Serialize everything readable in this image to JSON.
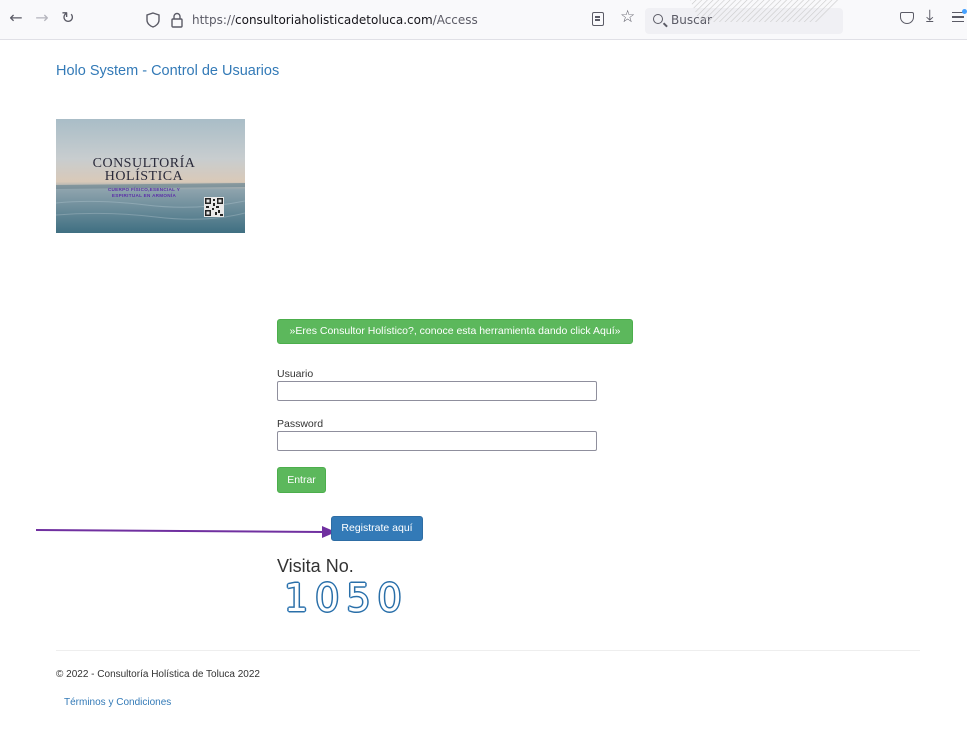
{
  "browser": {
    "url_prefix": "https://",
    "url_host": "consultoriaholisticadetoluca.com",
    "url_path": "/Access",
    "search_placeholder": "Buscar",
    "icons": [
      "back-arrow-icon",
      "forward-arrow-icon",
      "reload-icon",
      "shield-icon",
      "lock-icon",
      "reader-view-icon",
      "bookmark-star-icon",
      "search-icon",
      "pocket-icon",
      "download-icon",
      "menu-icon"
    ]
  },
  "header": {
    "brand": "Holo System - Control de Usuarios"
  },
  "banner": {
    "title_line1": "CONSULTORÍA",
    "title_line2": "HOLÍSTICA",
    "subtitle_line1": "CUERPO FÍSICO,ESENCIAL Y",
    "subtitle_line2": "ESPIRITUAL EN ARMONÍA"
  },
  "form": {
    "consultor_button": "»Eres Consultor Holístico?, conoce esta herramienta dando click Aquí»",
    "usuario_label": "Usuario",
    "usuario_value": "",
    "password_label": "Password",
    "password_value": "",
    "submit_label": "Entrar",
    "register_label": "Registrate aquí"
  },
  "visits": {
    "label": "Visita No.",
    "count": "1050"
  },
  "footer": {
    "copyright": "© 2022 - Consultoría Holística de Toluca 2022",
    "terms_link": "Términos y Condiciones"
  },
  "colors": {
    "link_blue": "#337ab7",
    "success_green": "#5cb85c",
    "primary_blue": "#337ab7",
    "annotation_arrow": "#7030a0"
  }
}
